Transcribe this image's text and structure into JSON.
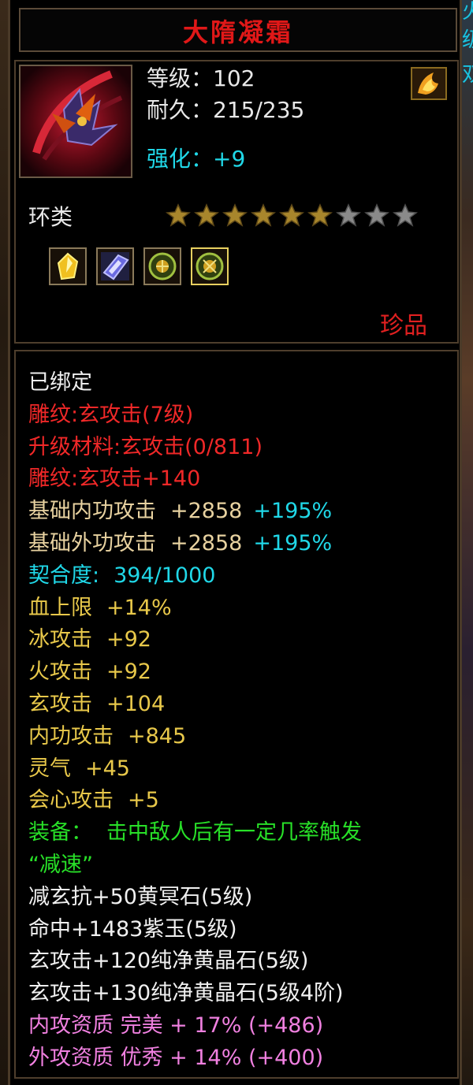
{
  "item": {
    "name": "大隋凝霜",
    "level": "等级：102",
    "durability": "耐久：215/235",
    "enhance": "强化：+9",
    "category": "环类",
    "stars_total": 9,
    "stars_filled": 6,
    "rarity": "珍品"
  },
  "gems": [
    {
      "icon": "yellow-crystal-icon"
    },
    {
      "icon": "purple-jade-icon"
    },
    {
      "icon": "green-stone-icon"
    },
    {
      "icon": "green-stone-highlighted-icon"
    }
  ],
  "props": {
    "bound": "已绑定",
    "engrave_label": "雕纹:玄攻击(7级)",
    "upgrade_material": "升级材料:玄攻击(0/811)",
    "engrave_bonus": "雕纹:玄攻击+140",
    "base_inner_label": "基础内功攻击",
    "base_inner_flat": "+2858",
    "base_inner_pct": "+195%",
    "base_outer_label": "基础外功攻击",
    "base_outer_flat": "+2858",
    "base_outer_pct": "+195%",
    "fit_label": "契合度:",
    "fit_value": "394/1000",
    "hp_label": "血上限",
    "hp_value": "+14%",
    "ice_label": "冰攻击",
    "ice_value": "+92",
    "fire_label": "火攻击",
    "fire_value": "+92",
    "xuan_label": "玄攻击",
    "xuan_value": "+104",
    "inner_label": "内功攻击",
    "inner_value": "+845",
    "spirit_label": "灵气",
    "spirit_value": "+45",
    "crit_label": "会心攻击",
    "crit_value": "+5",
    "equip_label": "装备：",
    "equip_effect": "击中敌人后有一定几率触发",
    "equip_effect_name": "“减速”",
    "socket_1": "减玄抗+50黄冥石(5级)",
    "socket_2": "命中+1483紫玉(5级)",
    "socket_3": "玄攻击+120纯净黄晶石(5级)",
    "socket_4": "玄攻击+130纯净黄晶石(5级4阶)",
    "inner_quality": "内攻资质 完美 + 17% (+486)",
    "outer_quality": "外攻资质 优秀 + 14% (+400)"
  },
  "colors": {
    "title": "#e01818",
    "cyan": "#20d8e8",
    "gold": "#e8c84a",
    "green": "#28e028",
    "pink": "#f080e0",
    "red": "#f02828"
  }
}
